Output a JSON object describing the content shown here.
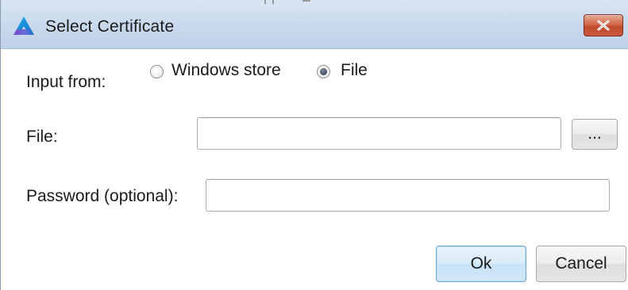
{
  "window": {
    "title": "Select Certificate",
    "app_icon": "app-logo-icon",
    "close_icon": "close-icon"
  },
  "input_from": {
    "label": "Input from:",
    "options": [
      {
        "label": "Windows store",
        "selected": false
      },
      {
        "label": "File",
        "selected": true
      }
    ]
  },
  "file": {
    "label": "File:",
    "value": "",
    "browse_label": "..."
  },
  "password": {
    "label": "Password (optional):",
    "value": ""
  },
  "buttons": {
    "ok_label": "Ok",
    "cancel_label": "Cancel"
  },
  "colors": {
    "titlebar": "#c9d9ec",
    "close_button": "#c24a2e",
    "default_button_border": "#6aa3d6"
  }
}
